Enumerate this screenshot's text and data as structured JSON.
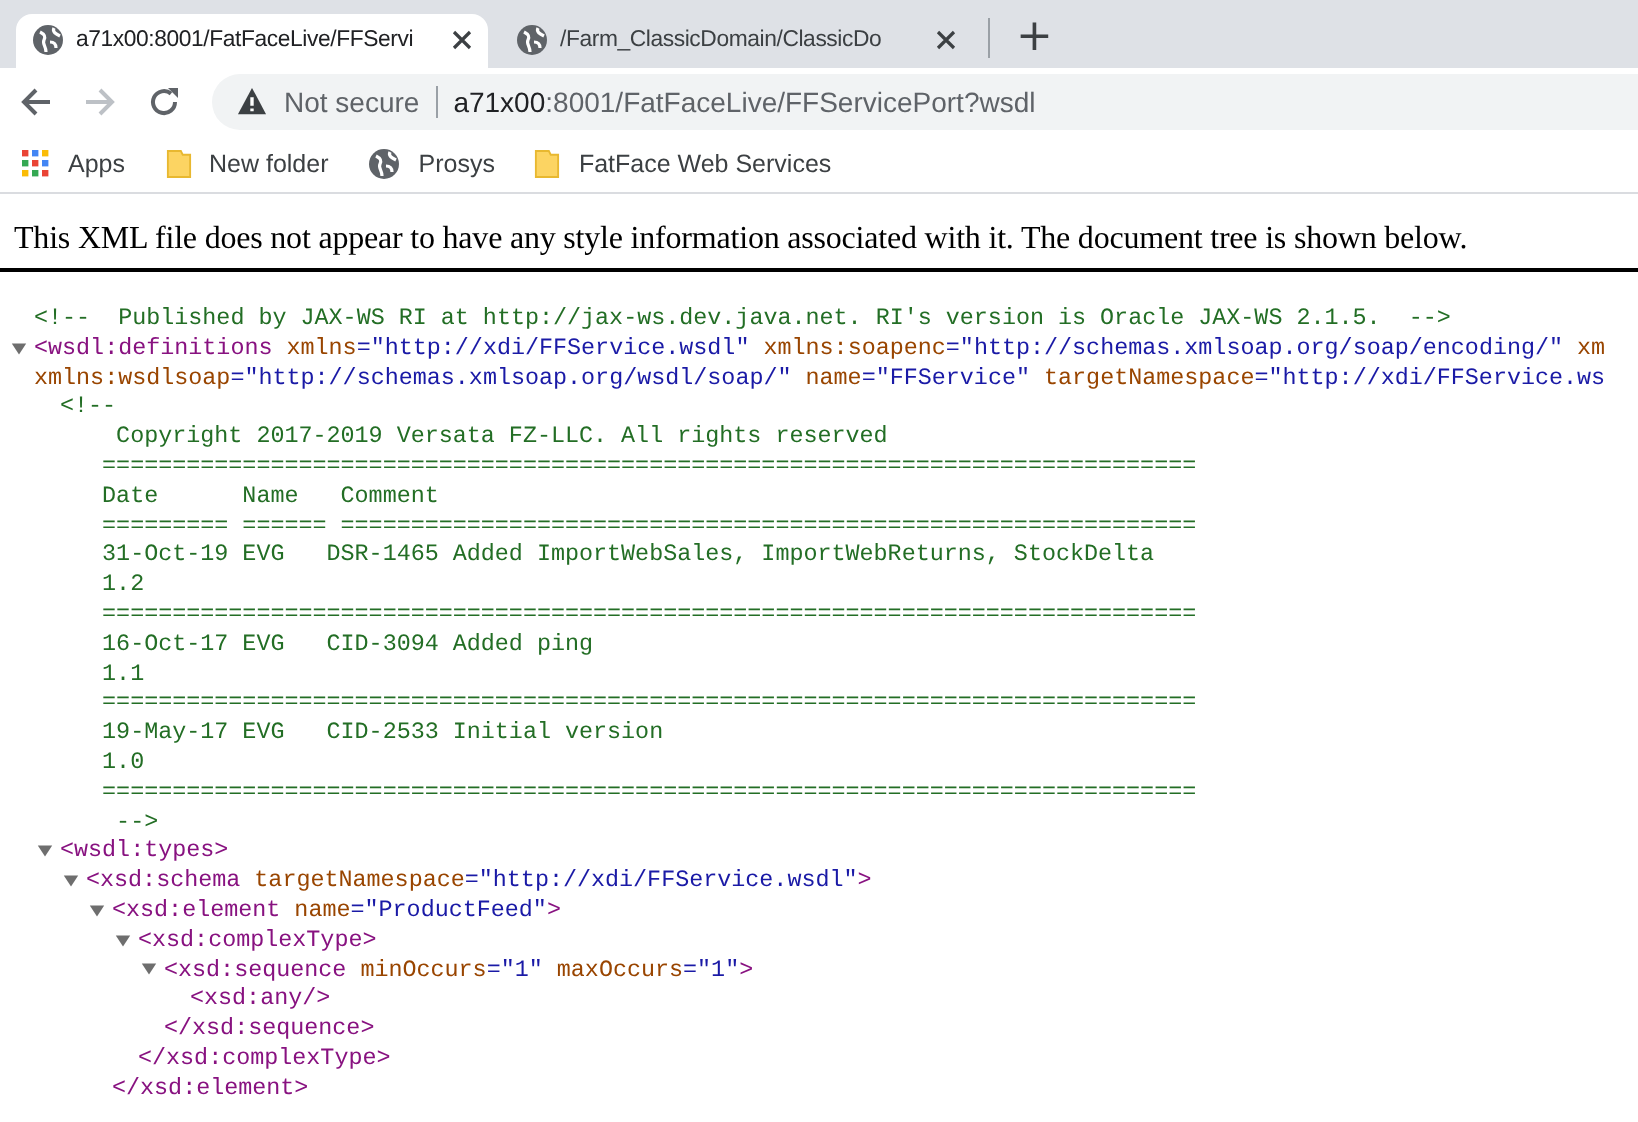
{
  "tabs": [
    {
      "title": "a71x00:8001/FatFaceLive/FFServi",
      "selected": true
    },
    {
      "title": "/Farm_ClassicDomain/ClassicDo",
      "selected": false
    }
  ],
  "new_tab": "+",
  "address_bar": {
    "security": "Not secure",
    "url": {
      "host": "a71x00",
      "path": ":8001/FatFaceLive/FFServicePort?wsdl"
    }
  },
  "bookmarks": [
    {
      "kind": "apps",
      "label": "Apps"
    },
    {
      "kind": "folder",
      "label": "New folder"
    },
    {
      "kind": "site",
      "label": "Prosys"
    },
    {
      "kind": "folder",
      "label": "FatFace Web Services"
    }
  ],
  "notice": "This XML file does not appear to have any style information associated with it. The document tree is shown below.",
  "xml_tree": [
    {
      "kind": "comment",
      "lines": [
        "<!--  Published by JAX-WS RI at http://jax-ws.dev.java.net. RI's version is Oracle JAX-WS 2.1.5.  -->"
      ]
    },
    {
      "kind": "element",
      "expanded": true,
      "open_lines": [
        [
          {
            "kind": "tag",
            "text": "<wsdl:definitions"
          },
          {
            "kind": "attr",
            "text": " xmlns"
          },
          {
            "kind": "value",
            "text": "=\"http://xdi/FFService.wsdl\""
          },
          {
            "kind": "attr",
            "text": " xmlns:soapenc"
          },
          {
            "kind": "value",
            "text": "=\"http://schemas.xmlsoap.org/soap/encoding/\""
          },
          {
            "kind": "attr",
            "text": " xm"
          }
        ],
        [
          {
            "kind": "attr",
            "text": "xmlns:wsdlsoap"
          },
          {
            "kind": "value",
            "text": "=\"http://schemas.xmlsoap.org/wsdl/soap/\""
          },
          {
            "kind": "attr",
            "text": " name"
          },
          {
            "kind": "value",
            "text": "=\"FFService\""
          },
          {
            "kind": "attr",
            "text": " targetNamespace"
          },
          {
            "kind": "value",
            "text": "=\"http://xdi/FFService.ws"
          }
        ]
      ],
      "children": [
        {
          "kind": "comment",
          "lines": [
            "<!--",
            "    Copyright 2017-2019 Versata FZ-LLC. All rights reserved",
            "   ==============================================================================",
            "   Date      Name   Comment",
            "   ========= ====== =============================================================",
            "   31-Oct-19 EVG   DSR-1465 Added ImportWebSales, ImportWebReturns, StockDelta",
            "   1.2",
            "   ==============================================================================",
            "   16-Oct-17 EVG   CID-3094 Added ping",
            "   1.1",
            "   ==============================================================================",
            "   19-May-17 EVG   CID-2533 Initial version",
            "   1.0",
            "   ==============================================================================",
            "    -->"
          ]
        },
        {
          "kind": "element",
          "expanded": true,
          "open_lines": [
            [
              {
                "kind": "tag",
                "text": "<wsdl:types>"
              }
            ]
          ],
          "children": [
            {
              "kind": "element",
              "expanded": true,
              "open_lines": [
                [
                  {
                    "kind": "tag",
                    "text": "<xsd:schema"
                  },
                  {
                    "kind": "attr",
                    "text": " targetNamespace"
                  },
                  {
                    "kind": "value",
                    "text": "=\"http://xdi/FFService.wsdl\""
                  },
                  {
                    "kind": "tag",
                    "text": ">"
                  }
                ]
              ],
              "children": [
                {
                  "kind": "element",
                  "expanded": true,
                  "open_lines": [
                    [
                      {
                        "kind": "tag",
                        "text": "<xsd:element"
                      },
                      {
                        "kind": "attr",
                        "text": " name"
                      },
                      {
                        "kind": "value",
                        "text": "=\"ProductFeed\""
                      },
                      {
                        "kind": "tag",
                        "text": ">"
                      }
                    ]
                  ],
                  "children": [
                    {
                      "kind": "element",
                      "expanded": true,
                      "open_lines": [
                        [
                          {
                            "kind": "tag",
                            "text": "<xsd:complexType>"
                          }
                        ]
                      ],
                      "children": [
                        {
                          "kind": "element",
                          "expanded": true,
                          "open_lines": [
                            [
                              {
                                "kind": "tag",
                                "text": "<xsd:sequence"
                              },
                              {
                                "kind": "attr",
                                "text": " minOccurs"
                              },
                              {
                                "kind": "value",
                                "text": "=\"1\""
                              },
                              {
                                "kind": "attr",
                                "text": " maxOccurs"
                              },
                              {
                                "kind": "value",
                                "text": "=\"1\""
                              },
                              {
                                "kind": "tag",
                                "text": ">"
                              }
                            ]
                          ],
                          "children": [
                            {
                              "kind": "leaf",
                              "open_lines": [
                                [
                                  {
                                    "kind": "tag",
                                    "text": "<xsd:any/>"
                                  }
                                ]
                              ]
                            }
                          ],
                          "close": "</xsd:sequence>"
                        }
                      ],
                      "close": "</xsd:complexType>"
                    }
                  ],
                  "close": "</xsd:element>"
                }
              ]
            }
          ]
        }
      ]
    }
  ]
}
